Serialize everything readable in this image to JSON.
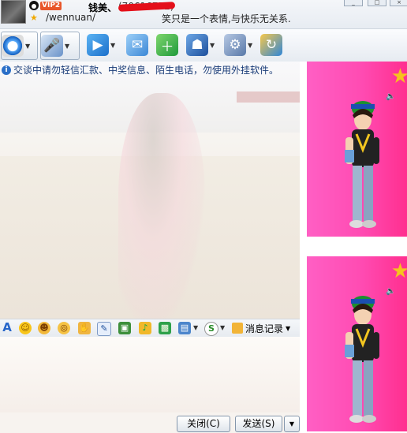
{
  "header": {
    "vip_label": "VIP2",
    "nickname": "钱美、",
    "qq_number": "(70616752)",
    "signature": "/wennuan/",
    "motto": "笑只是一个表情,与快乐无关系."
  },
  "window_controls": {
    "minimize": "_",
    "maximize": "□",
    "close": "×"
  },
  "toolbar": {
    "buttons": [
      {
        "icon": "webcam-icon",
        "has_dropdown": true
      },
      {
        "icon": "microphone-icon",
        "has_dropdown": true
      },
      {
        "icon": "folder-transfer-icon",
        "has_dropdown": true
      },
      {
        "icon": "send-image-icon",
        "has_dropdown": false
      },
      {
        "icon": "create-group-icon",
        "has_dropdown": false
      },
      {
        "icon": "app-center-icon",
        "has_dropdown": true
      },
      {
        "icon": "settings-icon",
        "has_dropdown": true
      },
      {
        "icon": "qq-show-icon",
        "has_dropdown": false
      }
    ]
  },
  "chat": {
    "notice": "交谈中请勿轻信汇款、中奖信息、陌生电话，勿使用外挂软件。"
  },
  "format_bar": {
    "font_letter": "A",
    "history_label": "消息记录"
  },
  "footer": {
    "close_label": "关闭(C)",
    "send_label": "发送(S)"
  },
  "colors": {
    "show_pink": "#ff4bb2",
    "accent_blue": "#2766c9",
    "redaction_red": "#e4101a"
  }
}
